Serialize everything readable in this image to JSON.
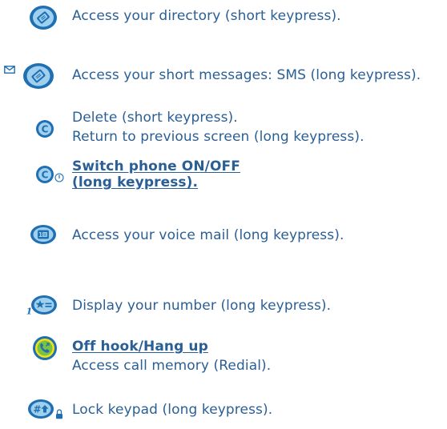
{
  "colors": {
    "text": "#2a5f96",
    "key_fill": "#1f6fb3",
    "key_light": "#9fd0ee",
    "green_key": "#7bc142",
    "yellow_key": "#f2e01b"
  },
  "entries": [
    {
      "icon": "directory-key-icon",
      "lines": [
        "Access your directory (short keypress)."
      ]
    },
    {
      "icon": "messages-key-icon",
      "extra_icon": "envelope-icon",
      "lines": [
        "Access your short messages: SMS (long keypress)."
      ]
    },
    {
      "icon": "clear-key-icon",
      "lines": [
        "Delete (short keypress).",
        "Return to previous screen (long keypress)."
      ]
    },
    {
      "icon": "clear-key-icon",
      "extra_icon": "power-icon",
      "lines": [
        "Switch phone ON/OFF",
        "(long keypress)."
      ]
    },
    {
      "icon": "voicemail-key-icon",
      "lines": [
        "Access your voice mail (long keypress)."
      ]
    },
    {
      "icon": "star-key-icon",
      "extra_icon": "one-icon",
      "lines": [
        "Display your number (long keypress)."
      ]
    },
    {
      "icon": "call-key-icon",
      "lines": [
        "Off hook/Hang up",
        "Access call memory (Redial)."
      ]
    },
    {
      "icon": "hash-key-icon",
      "extra_icon": "lock-icon",
      "lines": [
        "Lock keypad (long keypress)."
      ]
    }
  ]
}
